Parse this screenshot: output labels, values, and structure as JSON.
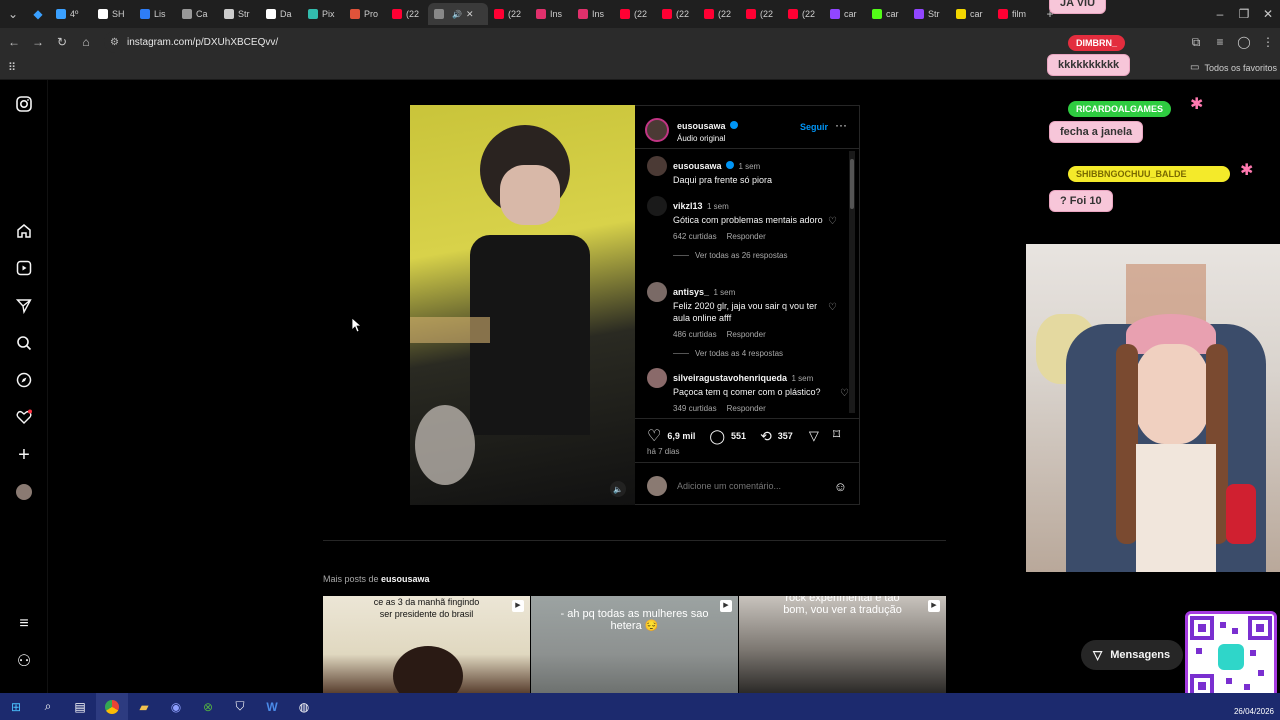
{
  "browser": {
    "tabs": [
      {
        "label": "4º",
        "color": "#3aa0ff"
      },
      {
        "label": "SH",
        "color": "#ffffff"
      },
      {
        "label": "Lis",
        "color": "#2e7df6"
      },
      {
        "label": "Ca",
        "color": "#999999"
      },
      {
        "label": "Str",
        "color": "#cccccc"
      },
      {
        "label": "Da",
        "color": "#ffffff"
      },
      {
        "label": "Pix",
        "color": "#32bcad"
      },
      {
        "label": "Pro",
        "color": "#e0533a"
      },
      {
        "label": "(22",
        "color": "#ff0033"
      },
      {
        "label": "",
        "color": "#888888",
        "active": true
      },
      {
        "label": "(22",
        "color": "#ff0033"
      },
      {
        "label": "Ins",
        "color": "#e1306c"
      },
      {
        "label": "Ins",
        "color": "#e1306c"
      },
      {
        "label": "(22",
        "color": "#ff0033"
      },
      {
        "label": "(22",
        "color": "#ff0033"
      },
      {
        "label": "(22",
        "color": "#ff0033"
      },
      {
        "label": "(22",
        "color": "#ff0033"
      },
      {
        "label": "(22",
        "color": "#ff0033"
      },
      {
        "label": "car",
        "color": "#9146ff"
      },
      {
        "label": "car",
        "color": "#53fc18"
      },
      {
        "label": "Str",
        "color": "#9146ff"
      },
      {
        "label": "car",
        "color": "#f2d600"
      },
      {
        "label": "film",
        "color": "#ff0033"
      }
    ],
    "url": "instagram.com/p/DXUhXBCEQvv/",
    "bookmarks_label": "Todos os favoritos"
  },
  "post": {
    "author": "eusousawa",
    "audio": "Áudio original",
    "follow_label": "Seguir",
    "caption": {
      "user": "eusousawa",
      "time": "1 sem",
      "text": "Daqui pra frente só piora"
    },
    "comments": [
      {
        "user": "vikzl13",
        "time": "1 sem",
        "text": "Gótica com problemas mentais adoro",
        "likes": "642 curtidas",
        "reply": "Responder",
        "replies": "Ver todas as 26 respostas"
      },
      {
        "user": "antisys_",
        "time": "1 sem",
        "text": "Feliz 2020 glr, jaja vou sair q vou ter aula online afff",
        "likes": "486 curtidas",
        "reply": "Responder",
        "replies": "Ver todas as 4 respostas"
      },
      {
        "user": "silveiragustavohenriqueda",
        "time": "1 sem",
        "text": "Paçoca tem q comer com o plástico?",
        "likes": "349 curtidas",
        "reply": "Responder"
      }
    ],
    "likes": "6,9 mil",
    "comments_count": "551",
    "reposts": "357",
    "posted": "há 7 dias",
    "comment_placeholder": "Adicione um comentário..."
  },
  "more_posts": {
    "prefix": "Mais posts de",
    "user": "eusousawa",
    "thumbs": [
      {
        "text": "ce as 3 da manhã fingindo ser presidente do brasil"
      },
      {
        "text": "- ah pq todas as mulheres sao hetera 😔"
      },
      {
        "text": "rock experimental é tão bom, vou ver a tradução"
      }
    ]
  },
  "messages_label": "Mensagens",
  "stream_chat": [
    {
      "name": "",
      "text": "JA VIU"
    },
    {
      "name": "DIMBRN_",
      "text": "kkkkkkkkkk"
    },
    {
      "name": "RICARDOALGAMES",
      "text": "fecha a janela"
    },
    {
      "name": "SHIBBNGOCHUU_BALDE",
      "text": "? Foi 10"
    }
  ],
  "taskbar": {
    "date": "26/04/2026"
  }
}
